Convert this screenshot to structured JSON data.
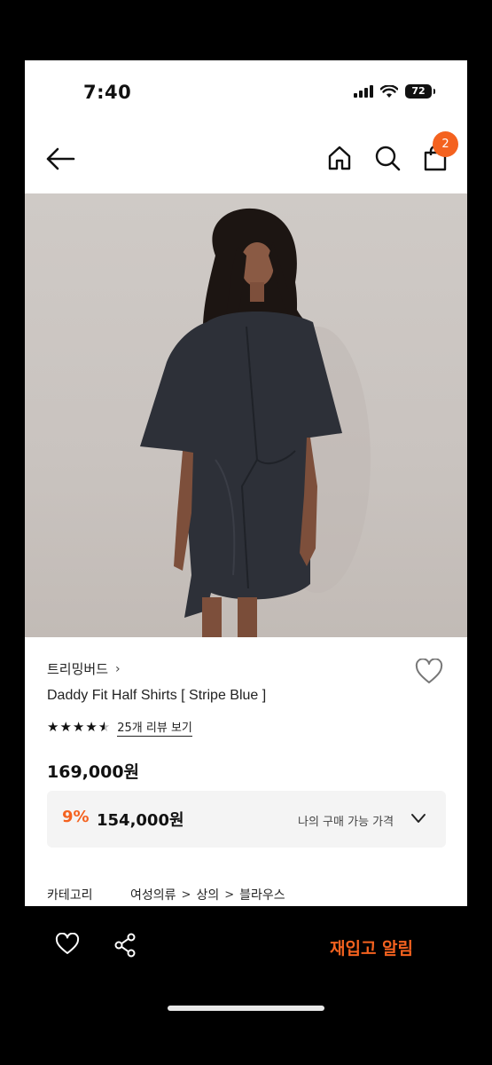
{
  "status_bar": {
    "time": "7:40",
    "battery": "72",
    "icons": [
      "signal-icon",
      "wifi-icon",
      "battery-icon"
    ]
  },
  "nav": {
    "icons": [
      "back-arrow-icon",
      "home-icon",
      "search-icon",
      "shopping-bag-icon"
    ],
    "cart_count": "2",
    "accent": "#f4621f"
  },
  "product": {
    "image": "product-photo",
    "brand": "트리밍버드",
    "brand_chevron": "›",
    "title": "Daddy Fit Half Shirts [ Stripe Blue ]",
    "rating": 4.5,
    "review_link": "25개 리뷰 보기",
    "price": "169,000원",
    "deal": {
      "discount": "9%",
      "price": "154,000원",
      "label": "나의 구매 가능 가격"
    },
    "category": {
      "label": "카테고리",
      "path": [
        "여성의류",
        "상의",
        "블라우스"
      ],
      "separator": ">"
    }
  },
  "bottom_bar": {
    "icons": [
      "heart-icon",
      "share-icon"
    ],
    "restock_label": "재입고 알림"
  }
}
